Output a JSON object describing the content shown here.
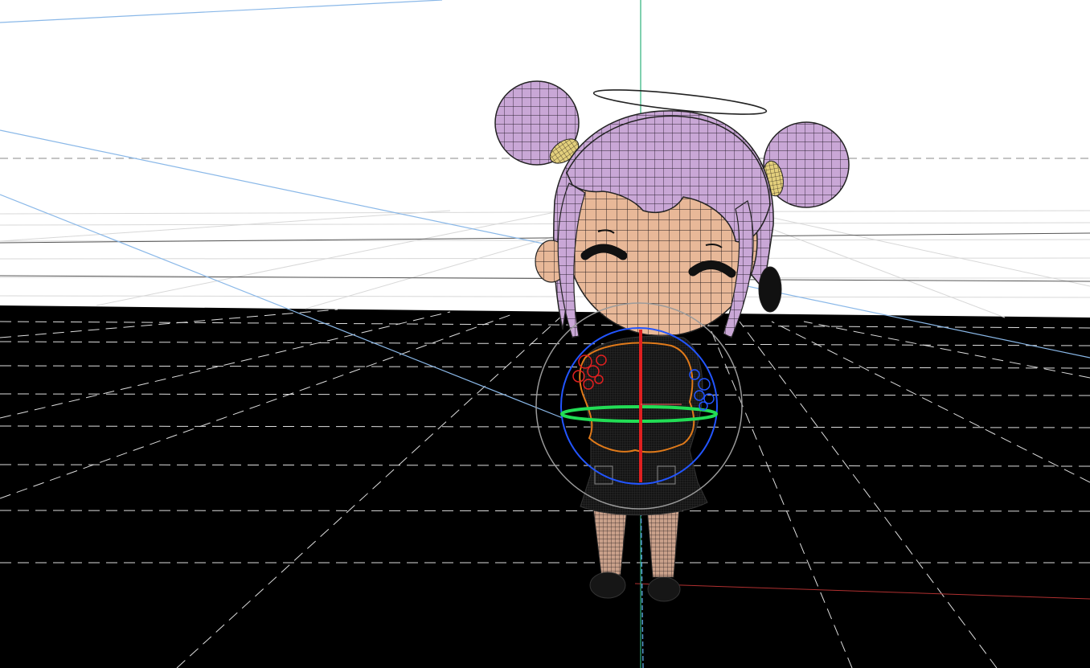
{
  "viewport": {
    "kind": "3d-viewport",
    "shading": "wireframe-on-shaded",
    "background_upper": "#ffffff",
    "background_lower": "#000000"
  },
  "scene": {
    "character": {
      "hair_color": "#c9a7d6",
      "skin_color": "#e8b898",
      "outfit_color": "#111111",
      "hair_tie_color": "#e3cf7c",
      "has_halo": true,
      "expression": "smiling-closed-eyes"
    },
    "gizmo": {
      "type": "rotate",
      "colors": {
        "x_axis": "#e02020",
        "y_axis": "#22dd55",
        "z_axis": "#2255ff",
        "view_ring": "#9a9a9a",
        "selection_outline": "#e07a1a"
      }
    },
    "axes": {
      "vertical_axis_color": "#2bb07a",
      "floor_axis_color": "#8ab8e8",
      "ground_x_axis_color": "#b03030"
    }
  }
}
